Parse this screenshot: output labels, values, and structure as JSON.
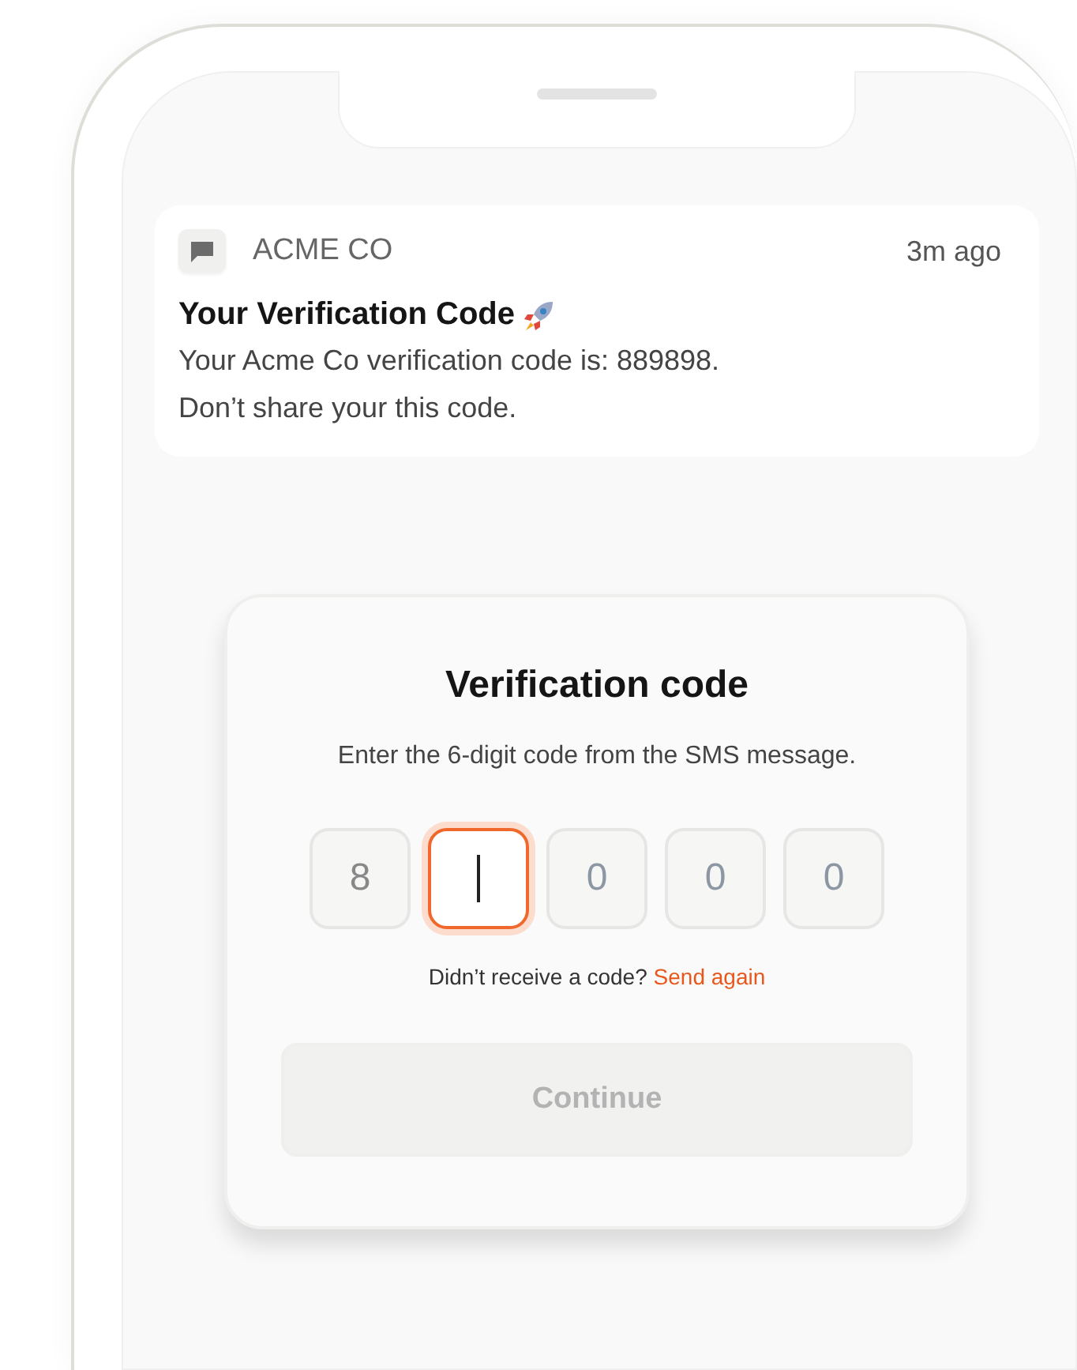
{
  "notification": {
    "app": "ACME CO",
    "time": "3m ago",
    "title": "Your Verification Code",
    "body_lines": [
      "Your Acme Co verification code is: 889898.",
      "Don’t share your this code."
    ]
  },
  "verification": {
    "title": "Verification code",
    "subtitle": "Enter the 6-digit code from the SMS message.",
    "digits": [
      {
        "value": "8",
        "focused": false
      },
      {
        "focused": true
      },
      {
        "placeholder": "0",
        "focused": false
      },
      {
        "placeholder": "0",
        "focused": false
      },
      {
        "placeholder": "0",
        "focused": false
      }
    ],
    "resend_prompt": "Didn’t receive a code?",
    "resend_link": "Send again",
    "continue_button": {
      "label": "Continue",
      "disabled": true
    }
  }
}
